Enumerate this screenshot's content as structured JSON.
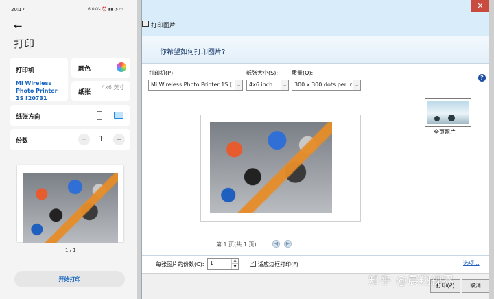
{
  "phone": {
    "status_time": "20:17",
    "status_right": "6.0K/s ⏰ ▮▮ ◔ ▭",
    "title": "打印",
    "printer_label": "打印机",
    "printer_name": "Mi Wireless Photo Printer 1S [20731",
    "color_label": "颜色",
    "paper_label": "纸张",
    "paper_value": "4x6 英寸",
    "orientation_label": "纸张方向",
    "copies_label": "份数",
    "copies_value": "1",
    "minus": "−",
    "plus": "+",
    "page_indicator": "1 / 1",
    "print_button": "开始打印"
  },
  "dialog": {
    "title": "打印图片",
    "close": "✕",
    "header_question": "你希望如何打印图片?",
    "printer_label": "打印机(P):",
    "printer_value": "Mi Wireless Photo Printer 1S [",
    "paper_size_label": "纸张大小(S):",
    "paper_size_value": "4x6 inch",
    "quality_label": "质量(Q):",
    "quality_value": "300 x 300 dots per ir",
    "help": "?",
    "page_nav": "第 1 页(共 1 页)",
    "thumb_label": "全页照片",
    "copies_label": "每张图片的份数(C):",
    "copies_value": "1",
    "fit_frame_label": "适应边框打印(F)",
    "options_link": "选项...",
    "print_button": "打印(P)",
    "cancel_button": "取消"
  },
  "watermark": "知乎 @晨翔视界",
  "colors": {
    "accent_blue": "#1565c0",
    "titlebar": "#d9ecf9",
    "close": "#c94a3f"
  }
}
